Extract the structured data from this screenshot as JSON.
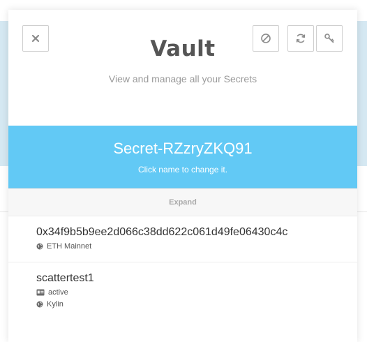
{
  "header": {
    "title": "Vault",
    "subtitle": "View and manage all your Secrets"
  },
  "toolbar": {
    "close_icon": "close-icon",
    "hide_icon": "ban-icon",
    "refresh_icon": "refresh-icon",
    "key_icon": "key-icon"
  },
  "secret": {
    "name": "Secret-RZzryZKQ91",
    "hint": "Click name to change it."
  },
  "expand": {
    "label": "Expand"
  },
  "accounts": [
    {
      "name": "0x34f9b5b9ee2d066c38dd622c061d49fe06430c4c",
      "network": "ETH Mainnet"
    },
    {
      "name": "scattertest1",
      "permission": "active",
      "network": "Kylin"
    }
  ],
  "colors": {
    "banner": "#62c9f5",
    "title": "#555555",
    "subtitle": "#9a9a9a",
    "backdrop": "#d5e8f2"
  }
}
